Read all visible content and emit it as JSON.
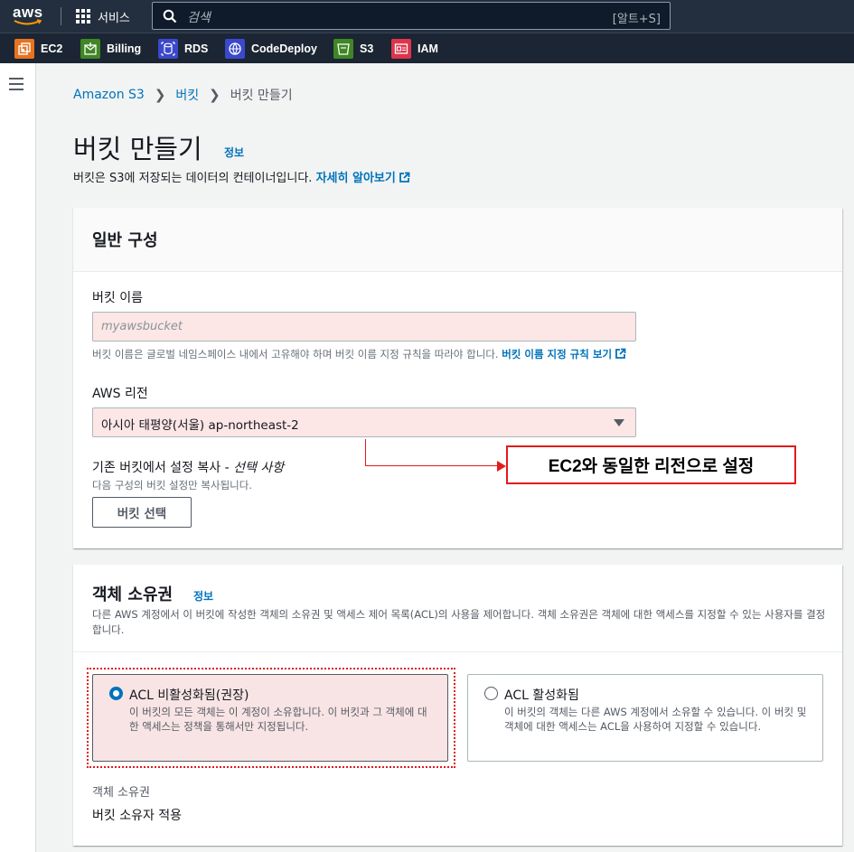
{
  "topnav": {
    "logo_text": "aws",
    "services_label": "서비스",
    "search_placeholder": "검색",
    "search_shortcut": "[알트+S]"
  },
  "favorites": [
    {
      "label": "EC2",
      "icon": "ec2-icon",
      "color": "#e8731f"
    },
    {
      "label": "Billing",
      "icon": "billing-icon",
      "color": "#3f8624"
    },
    {
      "label": "RDS",
      "icon": "rds-icon",
      "color": "#3b48cc"
    },
    {
      "label": "CodeDeploy",
      "icon": "codedeploy-icon",
      "color": "#3b48cc"
    },
    {
      "label": "S3",
      "icon": "s3-icon",
      "color": "#3f8624"
    },
    {
      "label": "IAM",
      "icon": "iam-icon",
      "color": "#dd344c"
    }
  ],
  "breadcrumb": {
    "items": [
      "Amazon S3",
      "버킷",
      "버킷 만들기"
    ]
  },
  "page": {
    "title": "버킷 만들기",
    "info_label": "정보",
    "subtitle": "버킷은 S3에 저장되는 데이터의 컨테이너입니다.",
    "subtitle_link": "자세히 알아보기"
  },
  "general": {
    "heading": "일반 구성",
    "bucket_name_label": "버킷 이름",
    "bucket_name_placeholder": "myawsbucket",
    "bucket_name_help": "버킷 이름은 글로벌 네임스페이스 내에서 고유해야 하며 버킷 이름 지정 규칙을 따라야 합니다.",
    "bucket_name_help_link": "버킷 이름 지정 규칙 보기",
    "region_label": "AWS 리전",
    "region_value": "아시아 태평양(서울) ap-northeast-2",
    "copy_label": "기존 버킷에서 설정 복사 - ",
    "copy_optional": "선택 사항",
    "copy_help": "다음 구성의 버킷 설정만 복사됩니다.",
    "choose_bucket_button": "버킷 선택"
  },
  "annotation": {
    "text": "EC2와 동일한 리전으로 설정",
    "color": "#e21b1b"
  },
  "ownership": {
    "heading": "객체 소유권",
    "info_label": "정보",
    "description": "다른 AWS 계정에서 이 버킷에 작성한 객체의 소유권 및 액세스 제어 목록(ACL)의 사용을 제어합니다. 객체 소유권은 객체에 대한 액세스를 지정할 수 있는 사용자를 결정합니다.",
    "options": [
      {
        "title": "ACL 비활성화됨(권장)",
        "desc": "이 버킷의 모든 객체는 이 계정이 소유합니다. 이 버킷과 그 객체에 대한 액세스는 정책을 통해서만 지정됩니다.",
        "selected": true
      },
      {
        "title": "ACL 활성화됨",
        "desc": "이 버킷의 객체는 다른 AWS 계정에서 소유할 수 있습니다. 이 버킷 및 객체에 대한 액세스는 ACL을 사용하여 지정할 수 있습니다.",
        "selected": false
      }
    ],
    "owner_label": "객체 소유권",
    "owner_value": "버킷 소유자 적용"
  }
}
